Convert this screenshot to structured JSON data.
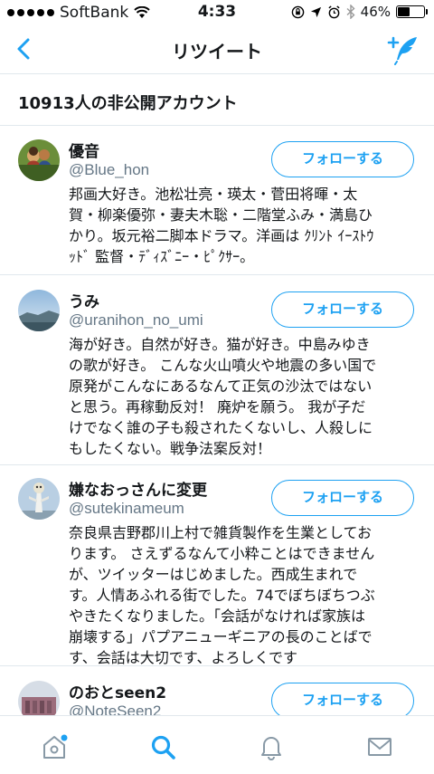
{
  "status_bar": {
    "carrier": "SoftBank",
    "time": "4:33",
    "battery": "46%",
    "battery_level": 0.46
  },
  "nav": {
    "title": "リツイート",
    "back_icon": "chevron-left-icon",
    "compose_icon": "compose-tweet-icon"
  },
  "section": {
    "label": "10913人の非公開アカウント"
  },
  "users": [
    {
      "name": "優音",
      "handle": "@Blue_hon",
      "bio": "邦画大好き。池松壮亮・瑛太・菅田将暉・太\n賀・柳楽優弥・妻夫木聡・二階堂ふみ・満島ひ\nかり。坂元裕二脚本ドラマ。洋画は ｸﾘﾝﾄ ｲｰｽﾄｳ\nｯﾄﾞ 監督・ﾃﾞｨｽﾞﾆｰ・ﾋﾟｸｻｰ。",
      "follow_label": "フォローする"
    },
    {
      "name": "うみ",
      "handle": "@uranihon_no_umi",
      "bio": "海が好き。自然が好き。猫が好き。中島みゆき\nの歌が好き。 こんな火山噴火や地震の多い国で\n原発がこんなにあるなんて正気の沙汰ではない\nと思う。再稼動反対！ 廃炉を願う。 我が子だ\nけでなく誰の子も殺されたくないし、人殺しに\nもしたくない。戦争法案反対！",
      "follow_label": "フォローする"
    },
    {
      "name": "嫌なおっさんに変更",
      "handle": "@sutekinameum",
      "bio": "奈良県吉野郡川上村で雑貨製作を生業としてお\nります。 さえずるなんて小粋ことはできません\nが、ツイッターはじめました。西成生まれで\nす。人情あふれる街でした。74でぼちぼちつぶ\nやきたくなりました。「会話がなければ家族は\n崩壊する」パプアニューギニアの長のことばで\nす、会話は大切です、よろしくです",
      "follow_label": "フォローする"
    },
    {
      "name": "のおとseen2",
      "handle": "@NoteSeen2",
      "bio": "",
      "follow_label": "フォローする"
    }
  ],
  "tabbar": {
    "items": [
      "home-icon",
      "search-icon",
      "notifications-bell-icon",
      "messages-envelope-icon"
    ],
    "active": "search-icon"
  },
  "colors": {
    "accent": "#1da1f2",
    "secondary_text": "#657786",
    "divider": "#e1e8ed"
  }
}
